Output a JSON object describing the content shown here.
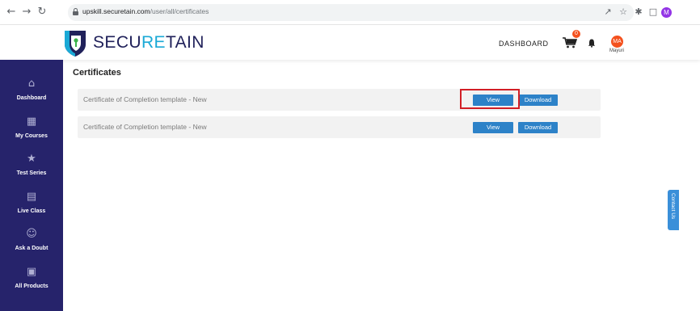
{
  "browser": {
    "url_host": "upskill.securetain.com",
    "url_path": "/user/all/certificates",
    "profile_initial": "M"
  },
  "brand": {
    "logo_part1": "SECU",
    "logo_part2": "RE",
    "logo_part3": "TAIN",
    "colors": {
      "navy": "#20215a",
      "cyan": "#1aa9d6",
      "sidebar": "#26236b",
      "button": "#2d82c8",
      "badge": "#f4511e"
    }
  },
  "header": {
    "nav_link": "DASHBOARD",
    "cart_count": "0",
    "user_initials": "MA",
    "user_name": "Mayuri"
  },
  "sidebar": {
    "items": [
      {
        "label": "Dashboard",
        "icon": "home-icon"
      },
      {
        "label": "My Courses",
        "icon": "courses-icon"
      },
      {
        "label": "Test Series",
        "icon": "test-series-icon"
      },
      {
        "label": "Live Class",
        "icon": "monitor-icon"
      },
      {
        "label": "Ask a Doubt",
        "icon": "group-icon"
      },
      {
        "label": "All Products",
        "icon": "box-icon"
      }
    ]
  },
  "main": {
    "title": "Certificates",
    "certificates": [
      {
        "name": "Certificate of Completion template - New",
        "view_label": "View",
        "download_label": "Download"
      },
      {
        "name": "Certificate of Completion template - New",
        "view_label": "View",
        "download_label": "Download"
      }
    ]
  },
  "contact": {
    "label": "Contact Us"
  }
}
